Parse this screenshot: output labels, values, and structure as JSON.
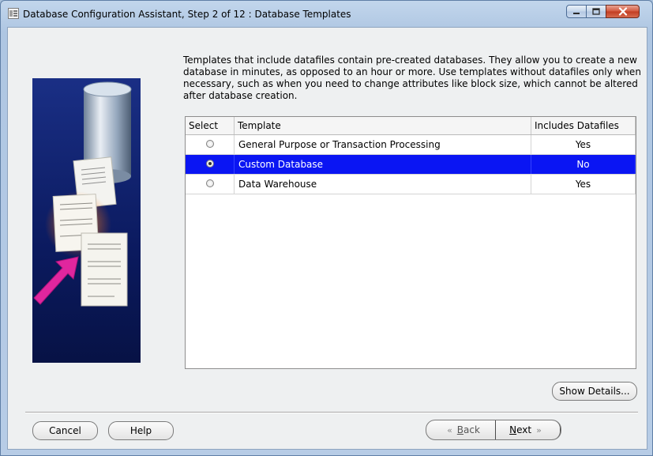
{
  "window": {
    "title": "Database Configuration Assistant, Step 2 of 12 : Database Templates",
    "controls": [
      "minimize-icon",
      "maximize-icon",
      "close-icon"
    ],
    "accent_color": "#0a15f3"
  },
  "intro_text": "Templates that include datafiles contain pre-created databases. They allow you to create a new database in minutes, as opposed to an hour or more. Use templates without datafiles only when necessary, such as when you need to change attributes like block size, which cannot be altered after database creation.",
  "table": {
    "columns": [
      "Select",
      "Template",
      "Includes Datafiles"
    ],
    "rows": [
      {
        "template": "General Purpose or Transaction Processing",
        "includes_datafiles": "Yes",
        "selected": false
      },
      {
        "template": "Custom Database",
        "includes_datafiles": "No",
        "selected": true
      },
      {
        "template": "Data Warehouse",
        "includes_datafiles": "Yes",
        "selected": false
      }
    ]
  },
  "buttons": {
    "show_details": "Show Details...",
    "cancel": "Cancel",
    "help": "Help",
    "back_label": "Back",
    "back_mnemonic": "B",
    "back_rest": "ack",
    "next_label": "Next",
    "next_mnemonic": "N",
    "next_rest": "ext"
  }
}
